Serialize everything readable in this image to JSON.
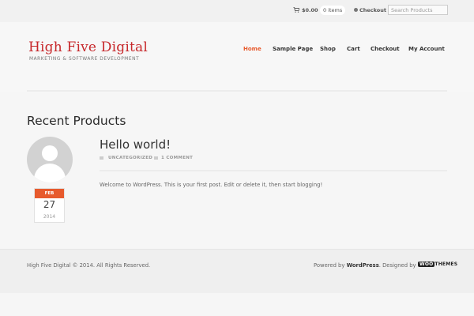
{
  "topbar": {
    "cart_amount": "$0.00",
    "cart_items": "0 items",
    "checkout": "Checkout",
    "search_placeholder": "Search Products"
  },
  "header": {
    "site_title": "High Five Digital",
    "tagline": "MARKETING & SOFTWARE DEVELOPMENT",
    "nav": [
      "Home",
      "Sample Page",
      "Shop",
      "Cart",
      "Checkout",
      "My Account"
    ]
  },
  "main": {
    "section_title": "Recent Products",
    "post": {
      "title": "Hello world!",
      "category": "UNCATEGORIZED",
      "comments": "1 COMMENT",
      "excerpt": "Welcome to WordPress. This is your first post. Edit or delete it, then start blogging!",
      "date": {
        "month": "FEB",
        "day": "27",
        "year": "2014"
      }
    }
  },
  "footer": {
    "copyright": "High Five Digital © 2014. All Rights Reserved.",
    "powered_prefix": "Powered by ",
    "powered_by": "WordPress",
    "designed_prefix": ". Designed by ",
    "designer_logo_a": "WOO",
    "designer_logo_b": "THEMES"
  },
  "colors": {
    "brand_red": "#c7282b",
    "accent_orange": "#e75a2d",
    "text_dark": "#333333"
  },
  "icons": [
    "cart-icon",
    "checkout-icon",
    "avatar-icon",
    "folder-icon",
    "comment-icon"
  ]
}
